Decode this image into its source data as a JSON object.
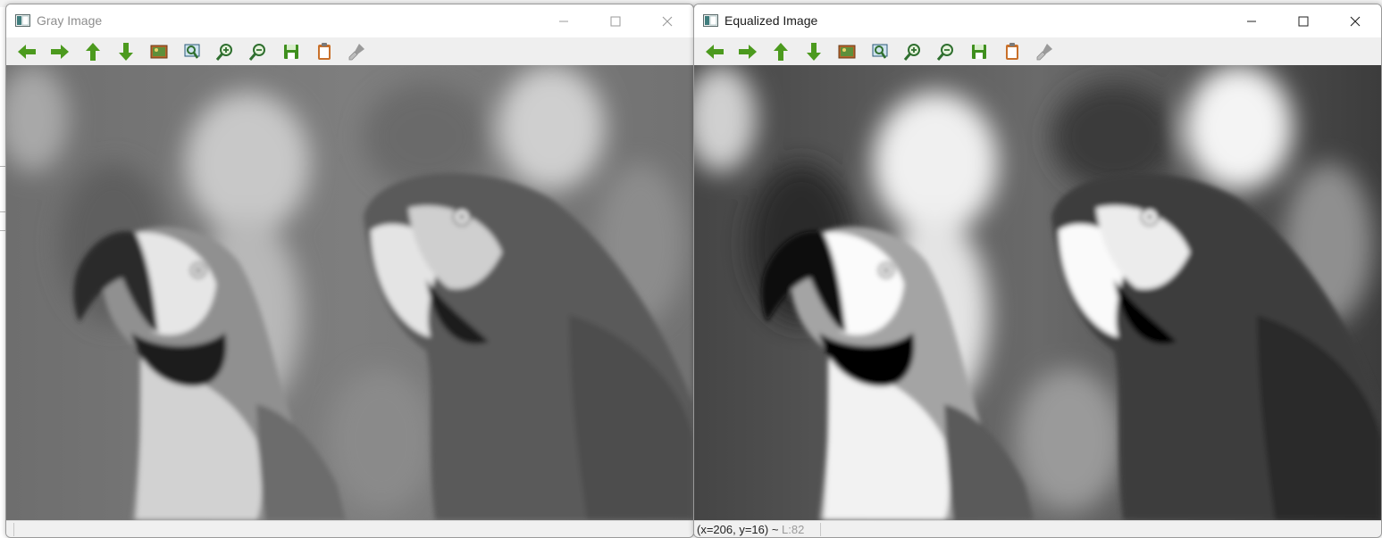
{
  "windows": [
    {
      "id": "gray",
      "title": "Gray Image",
      "active": false,
      "status_text": "",
      "toolbar": [
        "pan-left-icon",
        "pan-right-icon",
        "pan-up-icon",
        "pan-down-icon",
        "zoom-image-icon",
        "zoom-fit-icon",
        "zoom-in-icon",
        "zoom-out-icon",
        "save-icon",
        "copy-icon",
        "properties-icon"
      ]
    },
    {
      "id": "equalized",
      "title": "Equalized Image",
      "active": true,
      "status_text": "(x=206, y=16) ~",
      "status_value": "L:82",
      "toolbar": [
        "pan-left-icon",
        "pan-right-icon",
        "pan-up-icon",
        "pan-down-icon",
        "zoom-image-icon",
        "zoom-fit-icon",
        "zoom-in-icon",
        "zoom-out-icon",
        "save-icon",
        "copy-icon",
        "properties-icon"
      ]
    }
  ],
  "colors": {
    "toolbar_green": "#4c9a1e",
    "gray_image_tone": "#777777",
    "equalized_image_tone": "#555555"
  }
}
